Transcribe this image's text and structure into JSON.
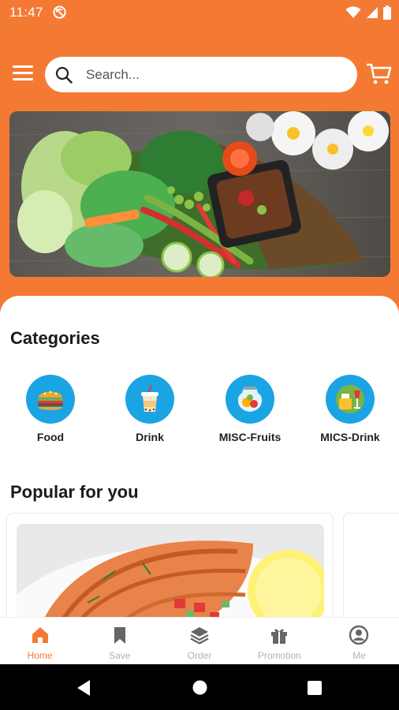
{
  "status_bar": {
    "time": "11:47"
  },
  "search": {
    "placeholder": "Search..."
  },
  "sections": {
    "categories_title": "Categories",
    "popular_title": "Popular for you"
  },
  "categories": [
    {
      "label": "Food",
      "icon": "burger-icon"
    },
    {
      "label": "Drink",
      "icon": "drink-cup-icon"
    },
    {
      "label": "MISC-Fruits",
      "icon": "fruit-bowl-icon"
    },
    {
      "label": "MICS-Drink",
      "icon": "drinks-icon"
    }
  ],
  "bottom_nav": [
    {
      "label": "Home",
      "icon": "home-icon",
      "active": true
    },
    {
      "label": "Save",
      "icon": "bookmark-icon",
      "active": false
    },
    {
      "label": "Order",
      "icon": "layers-icon",
      "active": false
    },
    {
      "label": "Promotion",
      "icon": "gift-icon",
      "active": false
    },
    {
      "label": "Me",
      "icon": "profile-icon",
      "active": false
    }
  ],
  "colors": {
    "brand": "#f47a34",
    "category_circle": "#1ba4e3",
    "inactive_nav": "#b0b0b0"
  }
}
